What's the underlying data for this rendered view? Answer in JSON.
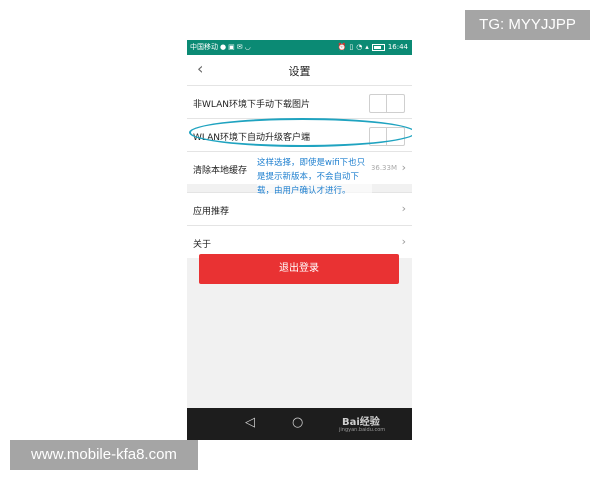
{
  "watermarks": {
    "top": "TG: MYYJJPP",
    "bottom": "www.mobile-kfa8.com"
  },
  "statusbar": {
    "carrier": "中国移动",
    "time": "16:44"
  },
  "header": {
    "title": "设置"
  },
  "settings": {
    "items": [
      {
        "label": "非WLAN环境下手动下载图片",
        "control": "toggle",
        "on": false
      },
      {
        "label": "WLAN环境下自动升级客户端",
        "control": "toggle",
        "on": false
      },
      {
        "label": "清除本地缓存",
        "value": "36.33M",
        "control": "chevron"
      },
      {
        "label": "应用推荐",
        "control": "chevron"
      },
      {
        "label": "关于",
        "control": "chevron"
      }
    ]
  },
  "annotation": {
    "text": "这样选择，即使是wifi下也只是提示新版本，不会自动下载，由用户确认才进行。",
    "color": "#1e7fcf"
  },
  "logout": {
    "label": "退出登录",
    "color": "#e93233"
  },
  "bottom_nav": {
    "brand": "Bai经验",
    "brand_sub": "jingyan.baidu.com"
  },
  "colors": {
    "statusbar": "#0b8a74",
    "highlight": "#1fa3c0"
  }
}
